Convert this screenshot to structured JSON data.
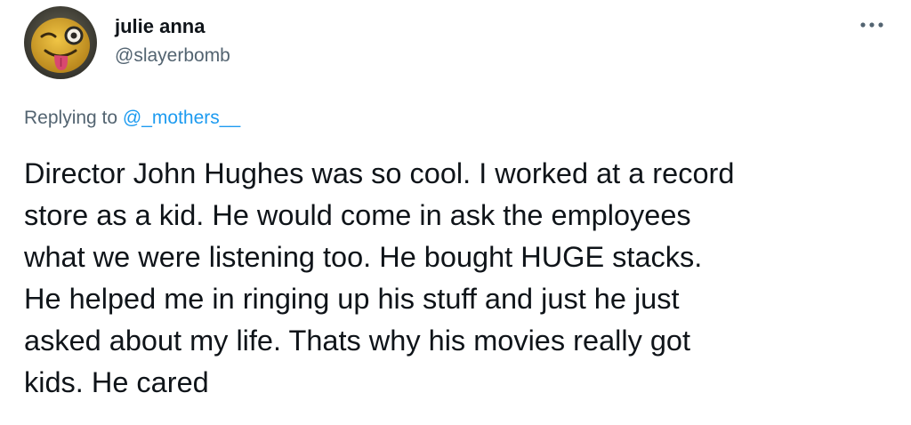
{
  "tweet": {
    "display_name": "julie anna",
    "handle": "@slayerbomb",
    "more_icon": "ellipsis-horizontal-icon",
    "avatar_icon": "winking-tongue-emoji-avatar",
    "replying_prefix": "Replying to ",
    "replying_mention": "@_mothers__",
    "body_lines": [
      "Director John Hughes was so cool. I worked at a record",
      "store as a kid. He would come in ask the employees",
      "what we were listening too. He bought HUGE stacks.",
      "He helped me in ringing up his stuff and just he just",
      "asked about my life. Thats why his movies really got",
      "kids. He cared"
    ]
  },
  "colors": {
    "text_primary": "#0f1419",
    "text_secondary": "#536471",
    "link": "#1d9bf0",
    "background": "#ffffff",
    "avatar_face": "#d9a72a"
  }
}
